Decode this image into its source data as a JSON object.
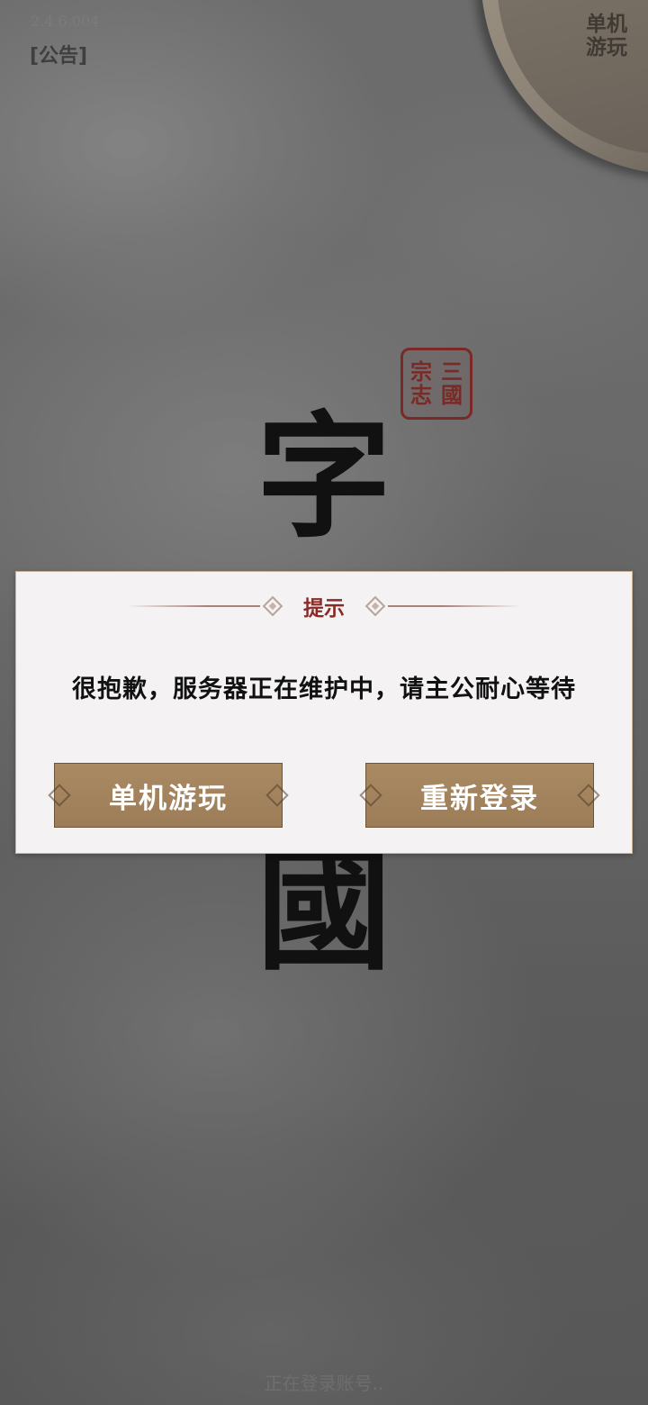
{
  "version": "2.4.6.004",
  "header": {
    "notice_label": "[公告]",
    "offline_corner_label": "单机游玩"
  },
  "logo": {
    "seal_chars": [
      "三",
      "國",
      "宗",
      "志"
    ],
    "title_chars": [
      "字",
      "國"
    ]
  },
  "dialog": {
    "title": "提示",
    "message": "很抱歉，服务器正在维护中，请主公耐心等待",
    "buttons": {
      "offline_label": "单机游玩",
      "relogin_label": "重新登录"
    },
    "accent_color": "#8a2b28",
    "button_color": "#a98a63"
  },
  "status": {
    "loading_text": "正在登录账号.."
  }
}
